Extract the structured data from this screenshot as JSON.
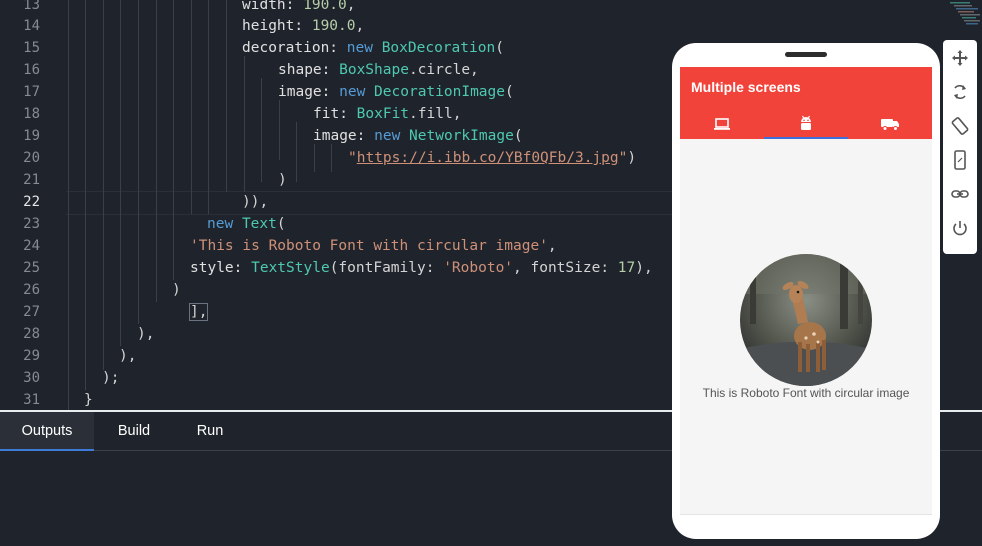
{
  "editor": {
    "line_numbers": [
      "13",
      "14",
      "15",
      "16",
      "17",
      "18",
      "19",
      "20",
      "21",
      "22",
      "23",
      "24",
      "25",
      "26",
      "27",
      "28",
      "29",
      "30",
      "31"
    ],
    "active_line": "22",
    "code": {
      "l13_a": "width: ",
      "l13_b": "190.0",
      "l13_c": ",",
      "l14_a": "height: ",
      "l14_b": "190.0",
      "l14_c": ",",
      "l15_a": "decoration: ",
      "l15_b": "new",
      "l15_c": "BoxDecoration",
      "l15_d": "(",
      "l16_a": "shape: ",
      "l16_b": "BoxShape",
      "l16_c": ".circle,",
      "l17_a": "image: ",
      "l17_b": "new",
      "l17_c": "DecorationImage",
      "l17_d": "(",
      "l18_a": "fit: ",
      "l18_b": "BoxFit",
      "l18_c": ".fill,",
      "l19_a": "image: ",
      "l19_b": "new",
      "l19_c": "NetworkImage",
      "l19_d": "(",
      "l20_q1": "\"",
      "l20_url": "https://i.ibb.co/YBf0QFb/3.jpg",
      "l20_q2": "\"",
      "l20_p": ")",
      "l21": ")",
      "l22": ")),",
      "l23_a": "new",
      "l23_b": "Text",
      "l23_c": "(",
      "l24_a": "'This is Roboto Font with circular image'",
      "l24_b": ",",
      "l25_a": "style: ",
      "l25_b": "TextStyle",
      "l25_c": "(fontFamily: ",
      "l25_d": "'Roboto'",
      "l25_e": ", fontSize: ",
      "l25_f": "17",
      "l25_g": "),",
      "l26": ")",
      "l27": "],",
      "l28": "),",
      "l29": "),",
      "l30": ");",
      "l31": "}"
    }
  },
  "panel": {
    "tabs": [
      {
        "label": "Outputs",
        "active": true
      },
      {
        "label": "Build",
        "active": false
      },
      {
        "label": "Run",
        "active": false
      }
    ]
  },
  "device": {
    "app_title": "Multiple screens",
    "tabs": [
      {
        "icon": "laptop-icon",
        "selected": false
      },
      {
        "icon": "android-icon",
        "selected": true
      },
      {
        "icon": "truck-icon",
        "selected": false
      }
    ],
    "image_subject": "deer",
    "caption": "This is Roboto Font with circular image",
    "appbar_color": "#f2433a",
    "indicator_color": "#3f6fd8"
  },
  "toolbar": {
    "buttons": [
      "move-icon",
      "rotate-icon",
      "rotate-device-icon",
      "phone-icon",
      "link-icon",
      "power-icon"
    ]
  },
  "colors": {
    "editor_bg": "#1f232b",
    "keyword": "#569cd6",
    "class": "#4ec9b0",
    "string": "#ce9178",
    "number": "#b5cea8"
  }
}
